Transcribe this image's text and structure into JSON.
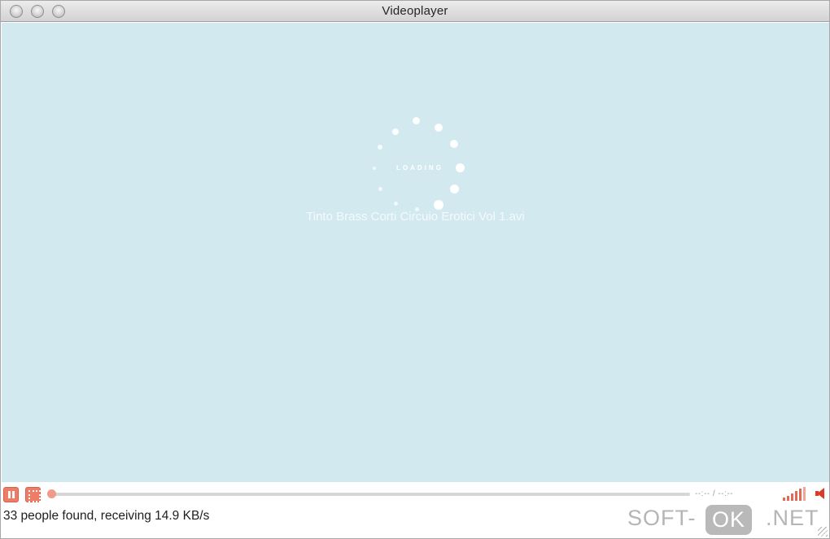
{
  "window": {
    "title": "Videoplayer"
  },
  "video": {
    "loading_label": "LOADING",
    "filename": "Tinto Brass Corti Circuio Erotici Vol 1.avi"
  },
  "controls": {
    "pause_icon": "pause-icon",
    "fullscreen_icon": "fullscreen-icon",
    "seek_progress": 0,
    "time_display": "--:-- / --:--",
    "signal_icon": "signal-strength-icon",
    "volume_icon": "speaker-icon"
  },
  "status": {
    "text": "33 people found, receiving 14.9 KB/s"
  },
  "watermark": {
    "part1": "SOFT-",
    "part2": "OK",
    "part3": ".NET"
  },
  "colors": {
    "video_background": "#d3e9f0",
    "accent": "#ee7c66",
    "speaker": "#dd3b2a"
  }
}
